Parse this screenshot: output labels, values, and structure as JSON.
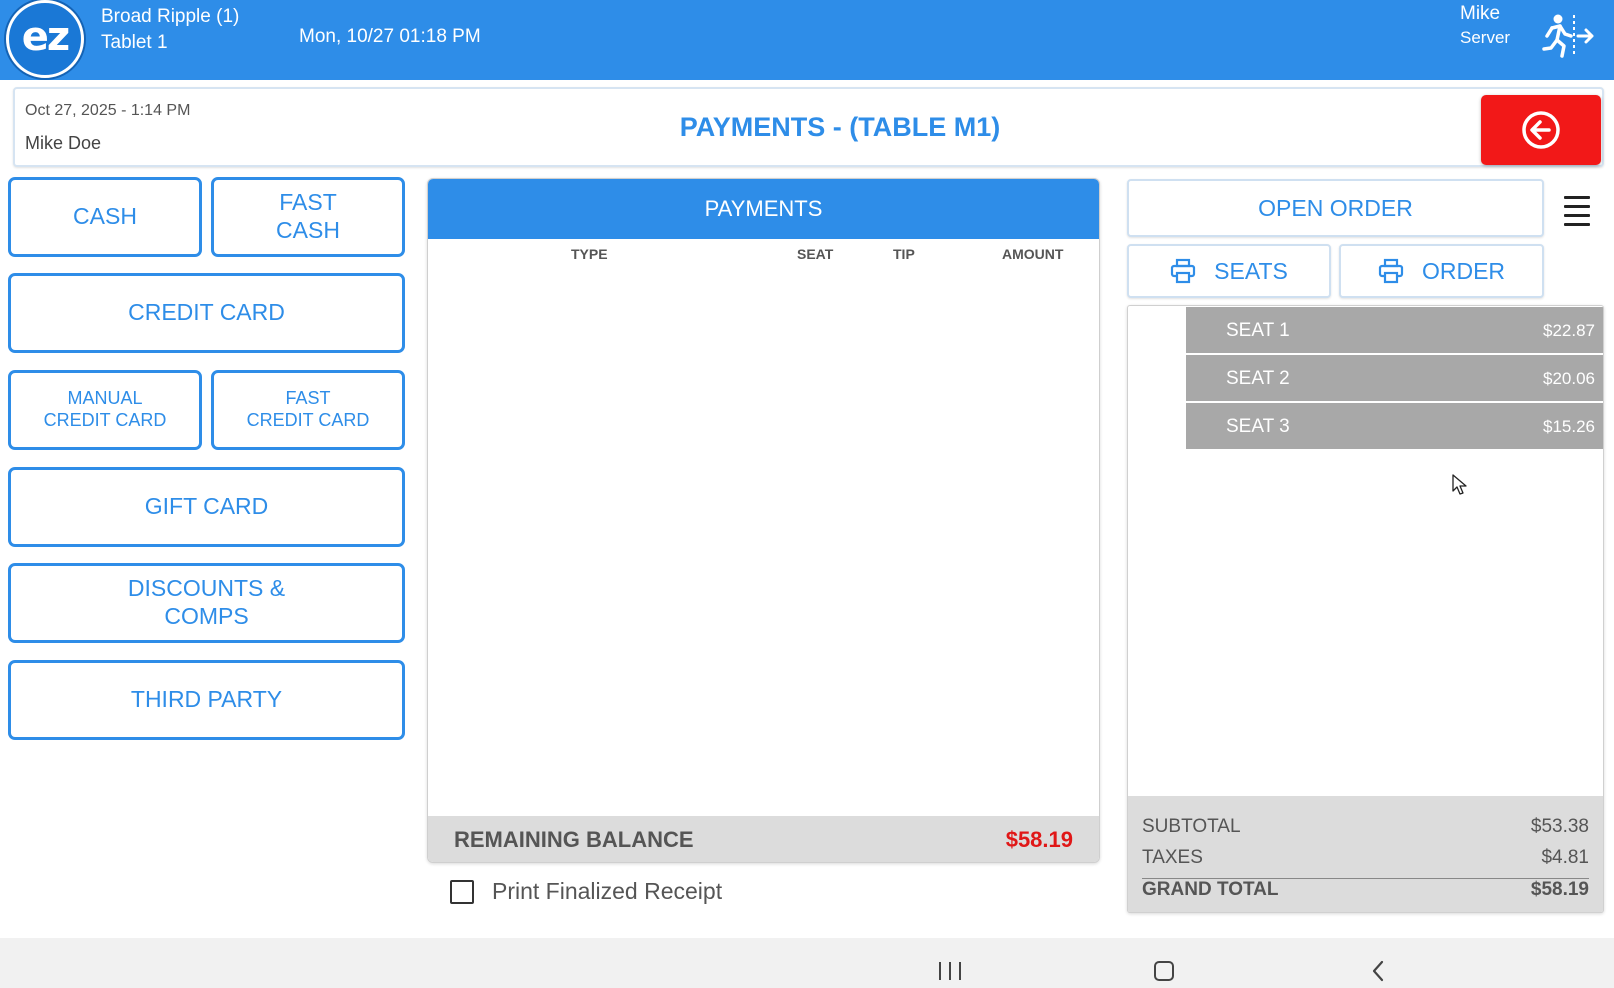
{
  "topbar": {
    "logo_text": "ez",
    "location": "Broad Ripple (1)",
    "device": "Tablet 1",
    "datetime": "Mon, 10/27 01:18 PM",
    "user_name": "Mike",
    "user_role": "Server",
    "logout_icon": "logout-person-icon",
    "bar_color": "#2e8de8"
  },
  "header": {
    "date": "Oct 27, 2025  - 1:14 PM",
    "user": "Mike Doe",
    "title": "PAYMENTS - (TABLE M1)",
    "back_icon": "back-arrow-circle-icon",
    "back_color": "#f21818"
  },
  "payment_methods": {
    "cash": "CASH",
    "fast_cash": "FAST\nCASH",
    "credit_card": "CREDIT CARD",
    "manual_credit_card": "MANUAL\nCREDIT CARD",
    "fast_credit_card": "FAST\nCREDIT CARD",
    "gift_card": "GIFT CARD",
    "discounts": "DISCOUNTS &\nCOMPS",
    "third_party": "THIRD PARTY"
  },
  "payments": {
    "heading": "PAYMENTS",
    "columns": [
      "TYPE",
      "SEAT",
      "TIP",
      "AMOUNT"
    ],
    "rows": [],
    "remaining_label": "REMAINING BALANCE",
    "remaining_value": "$58.19",
    "remaining_color": "#e01717"
  },
  "receipt": {
    "checked": false,
    "label": "Print Finalized Receipt"
  },
  "order_panel": {
    "open_order": "OPEN ORDER",
    "print_seats": "SEATS",
    "print_order": "ORDER",
    "print_icon": "printer-icon",
    "menu_icon": "hamburger-menu-icon",
    "seats": [
      {
        "label": "SEAT 1",
        "amount": "$22.87"
      },
      {
        "label": "SEAT 2",
        "amount": "$20.06"
      },
      {
        "label": "SEAT 3",
        "amount": "$15.26"
      }
    ],
    "subtotal_label": "SUBTOTAL",
    "subtotal": "$53.38",
    "taxes_label": "TAXES",
    "taxes": "$4.81",
    "grand_total_label": "GRAND TOTAL",
    "grand_total": "$58.19"
  },
  "android_nav": {
    "recent_icon": "recent-apps-icon",
    "home_icon": "home-icon",
    "back_icon": "back-chevron-icon"
  }
}
